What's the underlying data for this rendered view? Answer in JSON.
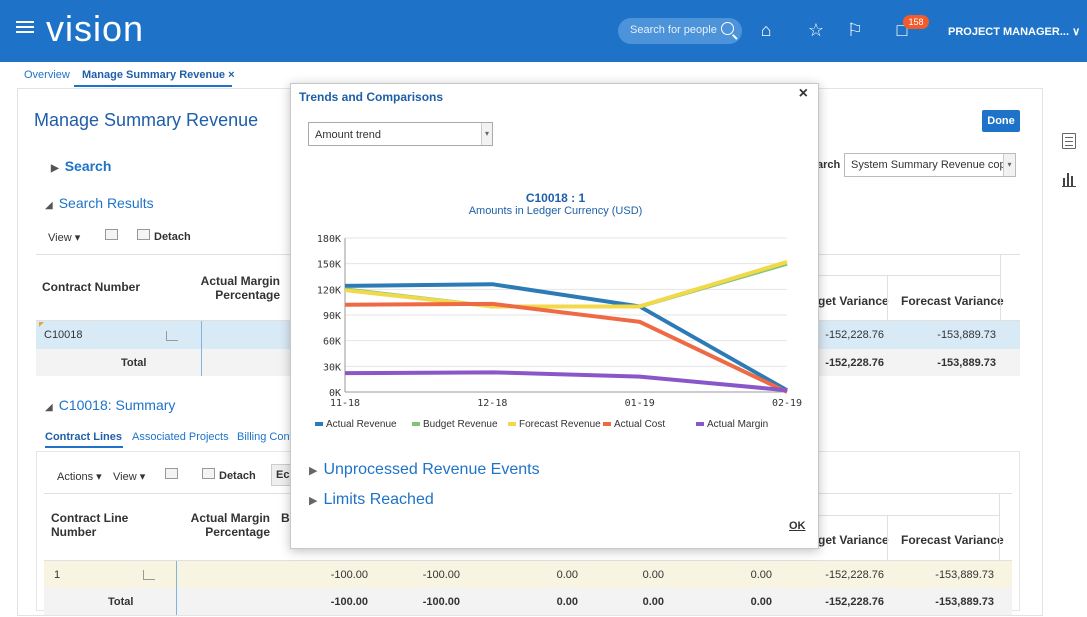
{
  "app": {
    "logo": "vision",
    "search_placeholder": "Search for people",
    "notification_count": "158",
    "user": "PROJECT MANAGER...",
    "user_caret": "∨"
  },
  "tabs": {
    "overview": "Overview",
    "active": "Manage Summary Revenue",
    "close": "×"
  },
  "page": {
    "title": "Manage Summary Revenue",
    "done": "Done",
    "search_section": "Search",
    "saved_search_label": "arch",
    "saved_search_value": "System Summary Revenue copy",
    "results_section": "Search Results",
    "view_menu": "View ▾",
    "detach": "Detach"
  },
  "results_table": {
    "headers": {
      "contract_number": "Contract Number",
      "actual_margin_pct": "Actual Margin Percentage",
      "budget_variance": "get Variance",
      "forecast_variance": "Forecast Variance"
    },
    "row": {
      "contract": "C10018",
      "budget_variance": "-152,228.76",
      "forecast_variance": "-153,889.73"
    },
    "total": {
      "label": "Total",
      "budget_variance": "-152,228.76",
      "forecast_variance": "-153,889.73"
    }
  },
  "summary": {
    "section": "C10018: Summary",
    "tabs": [
      "Contract Lines",
      "Associated Projects",
      "Billing Cont"
    ],
    "actions_menu": "Actions ▾",
    "view_menu": "View ▾",
    "detach": "Detach",
    "edit_partial": "Ec"
  },
  "lines_table": {
    "headers": {
      "line_number": "Contract Line Number",
      "actual_margin_pct": "Actual Margin Percentage",
      "partial": "B",
      "budget_variance": "get Variance",
      "forecast_variance": "Forecast Variance"
    },
    "row": {
      "line": "1",
      "c1": "-100.00",
      "c2": "-100.00",
      "c3": "0.00",
      "c4": "0.00",
      "c5": "0.00",
      "budget_variance": "-152,228.76",
      "forecast_variance": "-153,889.73"
    },
    "total": {
      "label": "Total",
      "c1": "-100.00",
      "c2": "-100.00",
      "c3": "0.00",
      "c4": "0.00",
      "c5": "0.00",
      "budget_variance": "-152,228.76",
      "forecast_variance": "-153,889.73"
    }
  },
  "modal": {
    "title": "Trends and Comparisons",
    "close": "×",
    "select_value": "Amount trend",
    "links": [
      "Unprocessed Revenue Events",
      "Limits Reached"
    ],
    "ok": "OK"
  },
  "chart_data": {
    "type": "line",
    "title": "C10018 : 1",
    "subtitle": "Amounts in Ledger Currency (USD)",
    "categories": [
      "11-18",
      "12-18",
      "01-19",
      "02-19"
    ],
    "y_ticks": [
      "0K",
      "30K",
      "60K",
      "90K",
      "120K",
      "150K",
      "180K"
    ],
    "ylim": [
      0,
      180000
    ],
    "grid": true,
    "legend_position": "bottom",
    "series": [
      {
        "name": "Actual Revenue",
        "color": "#2c7bb6",
        "values": [
          124000,
          126000,
          100000,
          2000
        ]
      },
      {
        "name": "Budget Revenue",
        "color": "#7dc47d",
        "values": [
          120000,
          100000,
          100000,
          150000
        ]
      },
      {
        "name": "Forecast Revenue",
        "color": "#f1d94a",
        "values": [
          119000,
          100000,
          100000,
          152000
        ]
      },
      {
        "name": "Actual Cost",
        "color": "#ee6a44",
        "values": [
          102000,
          103000,
          82000,
          0
        ]
      },
      {
        "name": "Actual Margin",
        "color": "#8a57c9",
        "values": [
          22000,
          23000,
          18000,
          2000
        ]
      }
    ]
  }
}
